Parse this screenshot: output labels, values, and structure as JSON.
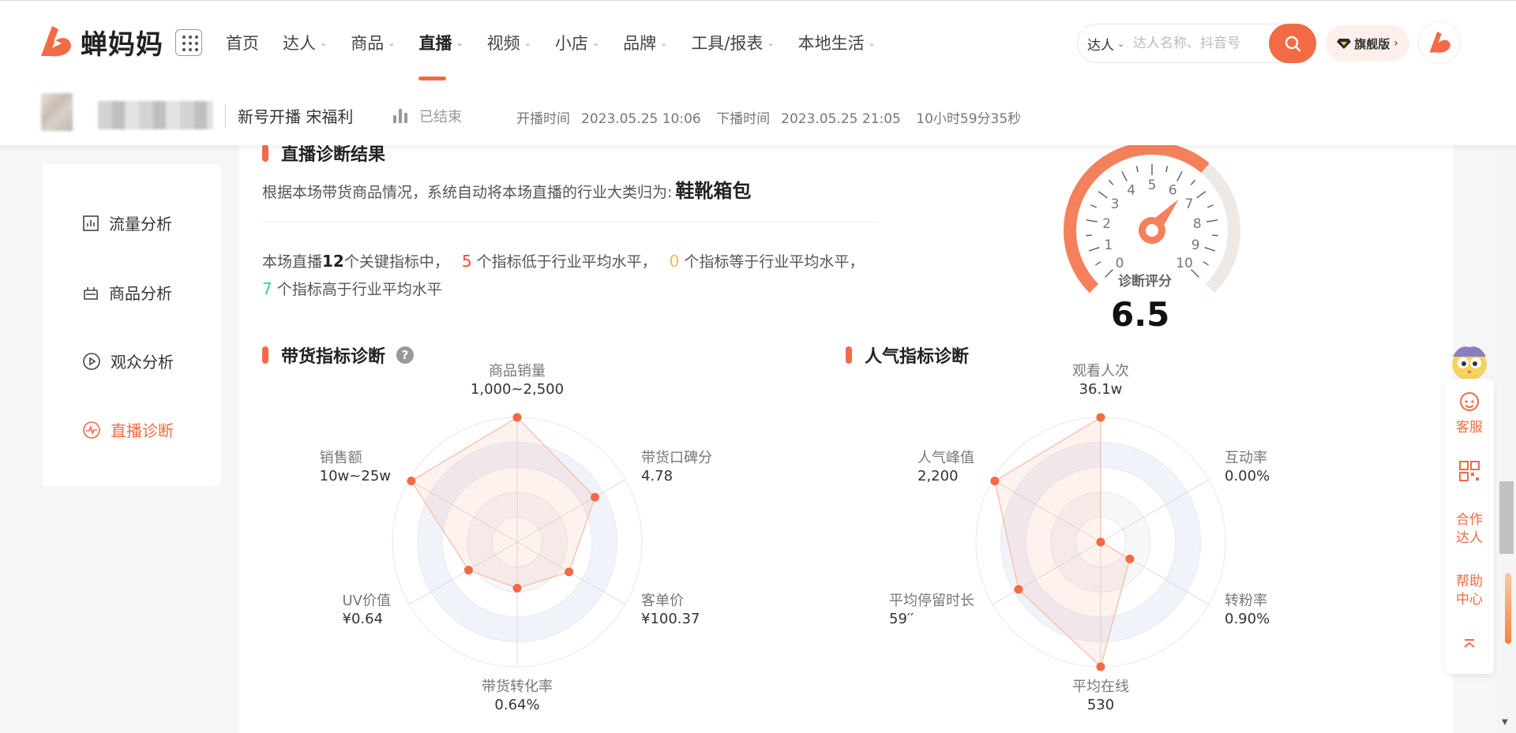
{
  "brand": {
    "name": "蝉妈妈",
    "accent": "#f26b45"
  },
  "nav": {
    "items": [
      {
        "label": "首页",
        "dropdown": false,
        "active": false
      },
      {
        "label": "达人",
        "dropdown": true,
        "active": false
      },
      {
        "label": "商品",
        "dropdown": true,
        "active": false
      },
      {
        "label": "直播",
        "dropdown": true,
        "active": true
      },
      {
        "label": "视频",
        "dropdown": true,
        "active": false
      },
      {
        "label": "小店",
        "dropdown": true,
        "active": false
      },
      {
        "label": "品牌",
        "dropdown": true,
        "active": false
      },
      {
        "label": "工具/报表",
        "dropdown": true,
        "active": false
      },
      {
        "label": "本地生活",
        "dropdown": true,
        "active": false
      }
    ],
    "chevron": "⌄"
  },
  "search": {
    "type": "达人",
    "placeholder": "达人名称、抖音号"
  },
  "vip": {
    "label": "旗舰版",
    "chevron": "›"
  },
  "live": {
    "title": "新号开播 宋福利",
    "status": "已结束",
    "start_label": "开播时间",
    "start_time": "2023.05.25 10:06",
    "end_label": "下播时间",
    "end_time": "2023.05.25 21:05",
    "duration": "10小时59分35秒"
  },
  "sidebar": {
    "items": [
      {
        "label": "流量分析",
        "icon": "bar-chart-icon",
        "active": false
      },
      {
        "label": "商品分析",
        "icon": "goods-icon",
        "active": false
      },
      {
        "label": "观众分析",
        "icon": "play-circle-icon",
        "active": false
      },
      {
        "label": "直播诊断",
        "icon": "pulse-icon",
        "active": true
      }
    ]
  },
  "diagnosis": {
    "title": "直播诊断结果",
    "intro": "根据本场带货商品情况，系统自动将本场直播的行业大类归为:",
    "category": "鞋靴箱包",
    "summary": {
      "prefix": "本场直播",
      "total": "12",
      "after_total": "个关键指标中，",
      "below_count": "5",
      "below_text": "个指标低于行业平均水平，",
      "equal_count": "0",
      "equal_text": "个指标等于行业平均水平，",
      "above_count": "7",
      "above_text": "个指标高于行业平均水平"
    },
    "score_label": "诊断评分",
    "score": "6.5",
    "score_value": 6.5,
    "gauge_ticks": [
      "0",
      "1",
      "2",
      "3",
      "4",
      "5",
      "6",
      "7",
      "8",
      "9",
      "10"
    ]
  },
  "sales_radar": {
    "title": "带货指标诊断",
    "help": "?",
    "axes": [
      {
        "name": "商品销量",
        "value": "1,000~2,500",
        "level": 1.0
      },
      {
        "name": "带货口碑分",
        "value": "4.78",
        "level": 0.72
      },
      {
        "name": "客单价",
        "value": "¥100.37",
        "level": 0.48
      },
      {
        "name": "带货转化率",
        "value": "0.64%",
        "level": 0.37
      },
      {
        "name": "UV价值",
        "value": "¥0.64",
        "level": 0.45
      },
      {
        "name": "销售额",
        "value": "10w~25w",
        "level": 0.98
      }
    ]
  },
  "popularity_radar": {
    "title": "人气指标诊断",
    "axes": [
      {
        "name": "观看人次",
        "value": "36.1w",
        "level": 1.0
      },
      {
        "name": "互动率",
        "value": "0.00%",
        "level": 0.0
      },
      {
        "name": "转粉率",
        "value": "0.90%",
        "level": 0.27
      },
      {
        "name": "平均在线",
        "value": "530",
        "level": 1.0
      },
      {
        "name": "平均停留时长",
        "value": "59′′",
        "level": 0.76
      },
      {
        "name": "人气峰值",
        "value": "2,200",
        "level": 0.98
      }
    ]
  },
  "float_bar": {
    "service": "客服",
    "partner": "合作达人",
    "help": "帮助中心",
    "top": "⌅"
  }
}
